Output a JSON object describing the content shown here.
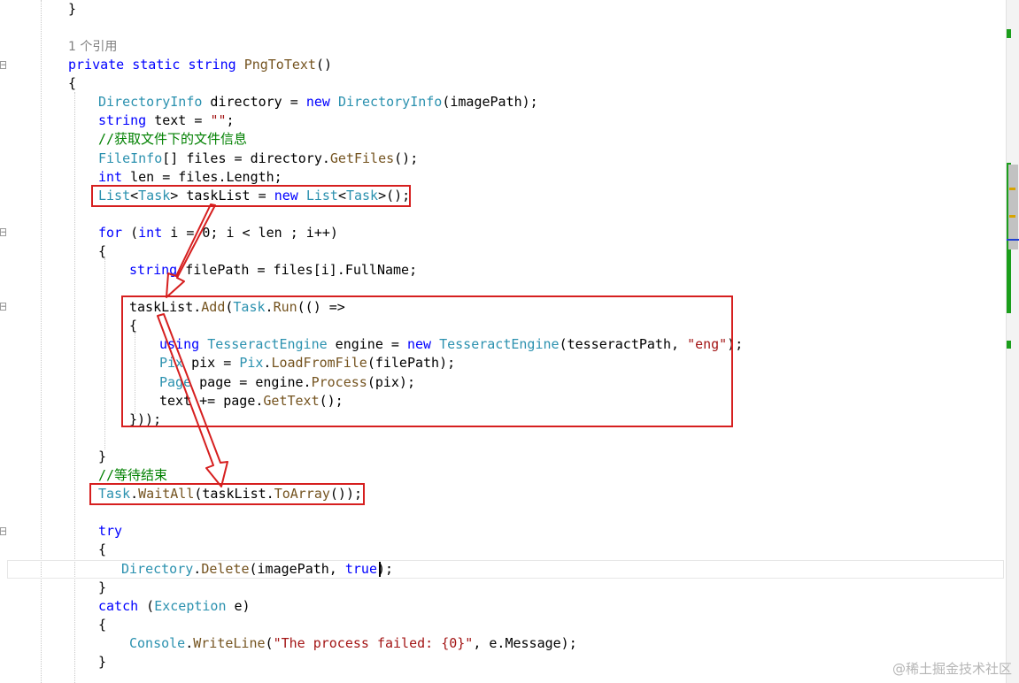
{
  "editor": {
    "lines": [
      {
        "id": "l0",
        "tokens": [
          [
            "p",
            "}"
          ]
        ]
      },
      {
        "id": "l1",
        "tokens": [
          [
            "ref",
            "1 个引用"
          ]
        ]
      },
      {
        "id": "l2",
        "tokens": [
          [
            "kw",
            "private"
          ],
          [
            "p",
            " "
          ],
          [
            "kw",
            "static"
          ],
          [
            "p",
            " "
          ],
          [
            "kw",
            "string"
          ],
          [
            "p",
            " "
          ],
          [
            "mt",
            "PngToText"
          ],
          [
            "p",
            "()"
          ]
        ]
      },
      {
        "id": "l3",
        "tokens": [
          [
            "p",
            "{"
          ]
        ]
      },
      {
        "id": "l4",
        "tokens": [
          [
            "ty",
            "DirectoryInfo"
          ],
          [
            "p",
            " directory = "
          ],
          [
            "kw",
            "new"
          ],
          [
            "p",
            " "
          ],
          [
            "ty",
            "DirectoryInfo"
          ],
          [
            "p",
            "(imagePath);"
          ]
        ]
      },
      {
        "id": "l5",
        "tokens": [
          [
            "kw",
            "string"
          ],
          [
            "p",
            " text = "
          ],
          [
            "st",
            "\"\""
          ],
          [
            "p",
            ";"
          ]
        ]
      },
      {
        "id": "l6",
        "tokens": [
          [
            "cm",
            "//获取文件下的文件信息"
          ]
        ]
      },
      {
        "id": "l7",
        "tokens": [
          [
            "ty",
            "FileInfo"
          ],
          [
            "p",
            "[] files = directory."
          ],
          [
            "mt",
            "GetFiles"
          ],
          [
            "p",
            "();"
          ]
        ]
      },
      {
        "id": "l8",
        "tokens": [
          [
            "kw",
            "int"
          ],
          [
            "p",
            " len = files.Length;"
          ]
        ]
      },
      {
        "id": "l9",
        "tokens": [
          [
            "ty",
            "List"
          ],
          [
            "p",
            "<"
          ],
          [
            "ty",
            "Task"
          ],
          [
            "p",
            "> taskList = "
          ],
          [
            "kw",
            "new"
          ],
          [
            "p",
            " "
          ],
          [
            "ty",
            "List"
          ],
          [
            "p",
            "<"
          ],
          [
            "ty",
            "Task"
          ],
          [
            "p",
            ">();"
          ]
        ]
      },
      {
        "id": "l10",
        "tokens": [
          [
            "kw",
            "for"
          ],
          [
            "p",
            " ("
          ],
          [
            "kw",
            "int"
          ],
          [
            "p",
            " i = 0; i < len ; i++)"
          ]
        ]
      },
      {
        "id": "l11",
        "tokens": [
          [
            "p",
            "{"
          ]
        ]
      },
      {
        "id": "l12",
        "tokens": [
          [
            "kw",
            "string"
          ],
          [
            "p",
            " filePath = files[i].FullName;"
          ]
        ]
      },
      {
        "id": "l13",
        "tokens": [
          [
            "p",
            "taskList."
          ],
          [
            "mt",
            "Add"
          ],
          [
            "p",
            "("
          ],
          [
            "ty",
            "Task"
          ],
          [
            "p",
            "."
          ],
          [
            "mt",
            "Run"
          ],
          [
            "p",
            "(() =>"
          ]
        ]
      },
      {
        "id": "l14",
        "tokens": [
          [
            "p",
            "{"
          ]
        ]
      },
      {
        "id": "l15",
        "tokens": [
          [
            "kw",
            "using"
          ],
          [
            "p",
            " "
          ],
          [
            "ty",
            "TesseractEngine"
          ],
          [
            "p",
            " engine = "
          ],
          [
            "kw",
            "new"
          ],
          [
            "p",
            " "
          ],
          [
            "ty",
            "TesseractEngine"
          ],
          [
            "p",
            "(tesseractPath, "
          ],
          [
            "st",
            "\"eng\""
          ],
          [
            "p",
            ");"
          ]
        ]
      },
      {
        "id": "l16",
        "tokens": [
          [
            "ty",
            "Pix"
          ],
          [
            "p",
            " pix = "
          ],
          [
            "ty",
            "Pix"
          ],
          [
            "p",
            "."
          ],
          [
            "mt",
            "LoadFromFile"
          ],
          [
            "p",
            "(filePath);"
          ]
        ]
      },
      {
        "id": "l17",
        "tokens": [
          [
            "ty",
            "Page"
          ],
          [
            "p",
            " page = engine."
          ],
          [
            "mt",
            "Process"
          ],
          [
            "p",
            "(pix);"
          ]
        ]
      },
      {
        "id": "l18",
        "tokens": [
          [
            "p",
            "text += page."
          ],
          [
            "mt",
            "GetText"
          ],
          [
            "p",
            "();"
          ]
        ]
      },
      {
        "id": "l19",
        "tokens": [
          [
            "p",
            "}));"
          ]
        ]
      },
      {
        "id": "l20",
        "tokens": [
          [
            "p",
            "}"
          ]
        ]
      },
      {
        "id": "l21",
        "tokens": [
          [
            "cm",
            "//等待结束"
          ]
        ]
      },
      {
        "id": "l22",
        "tokens": [
          [
            "ty",
            "Task"
          ],
          [
            "p",
            "."
          ],
          [
            "mt",
            "WaitAll"
          ],
          [
            "p",
            "(taskList."
          ],
          [
            "mt",
            "ToArray"
          ],
          [
            "p",
            "());"
          ]
        ]
      },
      {
        "id": "l23",
        "tokens": [
          [
            "kw",
            "try"
          ]
        ]
      },
      {
        "id": "l24",
        "tokens": [
          [
            "p",
            "{"
          ]
        ]
      },
      {
        "id": "l25",
        "tokens": [
          [
            "ty",
            "Directory"
          ],
          [
            "p",
            "."
          ],
          [
            "mt",
            "Delete"
          ],
          [
            "p",
            "(imagePath, "
          ],
          [
            "kw",
            "true"
          ],
          [
            "p",
            ");"
          ]
        ]
      },
      {
        "id": "l26",
        "tokens": [
          [
            "p",
            "}"
          ]
        ]
      },
      {
        "id": "l27",
        "tokens": [
          [
            "kw",
            "catch"
          ],
          [
            "p",
            " ("
          ],
          [
            "ty",
            "Exception"
          ],
          [
            "p",
            " e)"
          ]
        ]
      },
      {
        "id": "l28",
        "tokens": [
          [
            "p",
            "{"
          ]
        ]
      },
      {
        "id": "l29",
        "tokens": [
          [
            "ty",
            "Console"
          ],
          [
            "p",
            "."
          ],
          [
            "mt",
            "WriteLine"
          ],
          [
            "p",
            "("
          ],
          [
            "st",
            "\"The process failed: {0}\""
          ],
          [
            "p",
            ", e.Message);"
          ]
        ]
      },
      {
        "id": "l30",
        "tokens": [
          [
            "p",
            "}"
          ]
        ]
      }
    ]
  },
  "watermark": "@稀土掘金技术社区",
  "colors": {
    "keyword": "#0000ff",
    "type": "#2b91af",
    "method": "#74531f",
    "string": "#a31515",
    "comment": "#008000",
    "annotation": "#d61f1f"
  }
}
